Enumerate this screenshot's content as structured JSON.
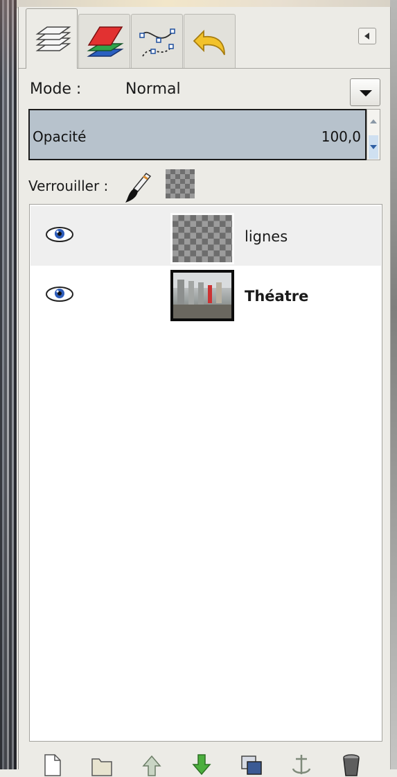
{
  "dock": {
    "tabs": [
      {
        "icon": "layers-icon",
        "active": true
      },
      {
        "icon": "channels-icon",
        "active": false
      },
      {
        "icon": "paths-icon",
        "active": false
      },
      {
        "icon": "undo-history-icon",
        "active": false
      }
    ],
    "menu_button_icon": "tab-menu-arrow-icon"
  },
  "mode": {
    "label": "Mode :",
    "value": "Normal"
  },
  "opacity": {
    "label": "Opacité",
    "value": "100,0"
  },
  "lock": {
    "label": "Verrouiller :",
    "icons": [
      "paintbrush-icon",
      "alpha-lock-icon"
    ]
  },
  "layers": [
    {
      "name": "lignes",
      "visible": true,
      "selected": true,
      "bold": false,
      "thumbnail": "transparent-checkerboard"
    },
    {
      "name": "Théatre",
      "visible": true,
      "selected": false,
      "bold": true,
      "thumbnail": "photo"
    }
  ],
  "toolbar": [
    "new-layer-icon",
    "new-layer-group-icon",
    "raise-layer-icon",
    "lower-layer-icon",
    "duplicate-layer-icon",
    "anchor-layer-icon",
    "delete-layer-icon"
  ],
  "colors": {
    "selection_row": "#efefef",
    "opacity_fill": "#b7c2cc",
    "raise_arrow": "#3fa03a",
    "lower_arrow": "#3fa03a"
  }
}
